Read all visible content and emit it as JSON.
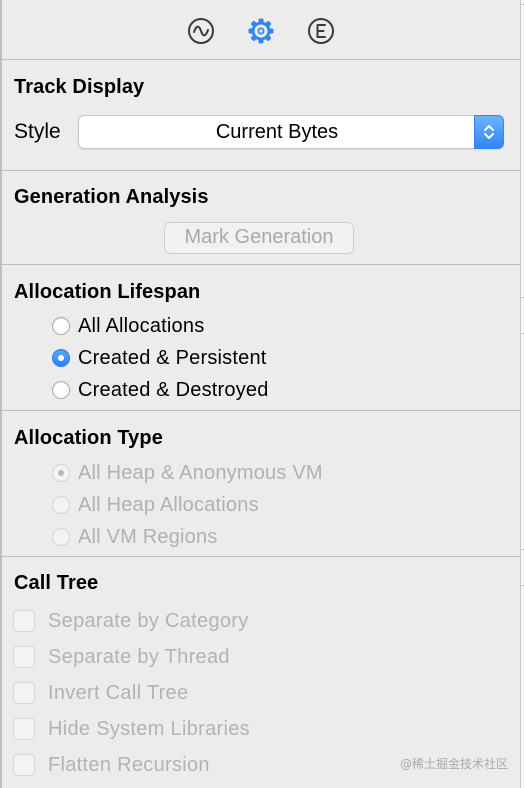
{
  "tabs": [
    {
      "icon": "waveform-icon",
      "name": "record-settings"
    },
    {
      "icon": "gear-icon",
      "name": "display-settings",
      "selected": true
    },
    {
      "icon": "extended-detail-icon",
      "name": "extended-detail"
    }
  ],
  "track_display": {
    "title": "Track Display",
    "style_label": "Style",
    "style_value": "Current Bytes"
  },
  "generation_analysis": {
    "title": "Generation Analysis",
    "button_label": "Mark Generation"
  },
  "allocation_lifespan": {
    "title": "Allocation Lifespan",
    "options": [
      {
        "label": "All Allocations",
        "checked": false
      },
      {
        "label": "Created & Persistent",
        "checked": true
      },
      {
        "label": "Created & Destroyed",
        "checked": false
      }
    ]
  },
  "allocation_type": {
    "title": "Allocation Type",
    "enabled": false,
    "options": [
      {
        "label": "All Heap & Anonymous VM",
        "checked": true
      },
      {
        "label": "All Heap Allocations",
        "checked": false
      },
      {
        "label": "All VM Regions",
        "checked": false
      }
    ]
  },
  "call_tree": {
    "title": "Call Tree",
    "enabled": false,
    "options": [
      {
        "label": "Separate by Category",
        "checked": false
      },
      {
        "label": "Separate by Thread",
        "checked": false
      },
      {
        "label": "Invert Call Tree",
        "checked": false
      },
      {
        "label": "Hide System Libraries",
        "checked": false
      },
      {
        "label": "Flatten Recursion",
        "checked": false
      }
    ]
  },
  "watermark": "@稀土掘金技术社区",
  "colors": {
    "accent": "#2f86f5",
    "panel_bg": "#ececec",
    "disabled_text": "#b1b1b1"
  }
}
